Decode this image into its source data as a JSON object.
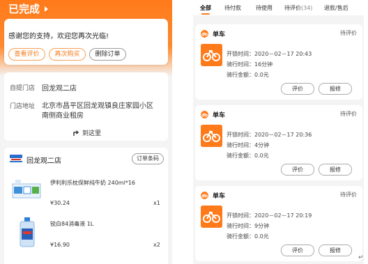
{
  "left": {
    "status_title": "已完成",
    "thanks_text": "感谢您的支持，欢迎您再次光临!",
    "buttons": {
      "review": "查看评价",
      "rebuy": "再次购买",
      "delete": "删除订单"
    },
    "store": {
      "pickup_label": "自提门店",
      "pickup_value": "回龙观二店",
      "address_label": "门店地址",
      "address_line1": "北京市昌平区回龙观镇良庄家园小区",
      "address_line2": "南侧商业租房",
      "go_here": "到这里"
    },
    "goods": {
      "shop_name": "回龙观二店",
      "barcode_button": "订单条码",
      "items": [
        {
          "name": "伊利利乐枕保鲜纯牛奶 240ml*16",
          "price": "¥30.24",
          "qty": "x1"
        },
        {
          "name": "锐白84消毒液 1L",
          "price": "¥16.90",
          "qty": "x2"
        }
      ]
    }
  },
  "right": {
    "tabs": [
      {
        "label": "全部"
      },
      {
        "label": "待付款"
      },
      {
        "label": "待使用"
      },
      {
        "label": "待评价",
        "count": "(34)"
      },
      {
        "label": "退款/售后"
      }
    ],
    "orders": [
      {
        "title": "单车",
        "status": "待评价",
        "unlock": "开锁时间：2020－02－17 20:43",
        "ride": "骑行时间：16分钟",
        "amount": "骑行金额：0.0元",
        "btn_review": "评价",
        "btn_repair": "报修"
      },
      {
        "title": "单车",
        "status": "待评价",
        "unlock": "开锁时间：2020－02－17 20:36",
        "ride": "骑行时间：4分钟",
        "amount": "骑行金额：0.0元",
        "btn_review": "评价",
        "btn_repair": "报修"
      },
      {
        "title": "单车",
        "status": "待评价",
        "unlock": "开锁时间：2020－02－17 20:19",
        "ride": "骑行时间：9分钟",
        "amount": "骑行金额：0.0元",
        "btn_review": "评价",
        "btn_repair": "报修"
      }
    ]
  },
  "colors": {
    "accent": "#ff7a1a",
    "background": "#f4f4f4"
  },
  "end_mark": "↵"
}
